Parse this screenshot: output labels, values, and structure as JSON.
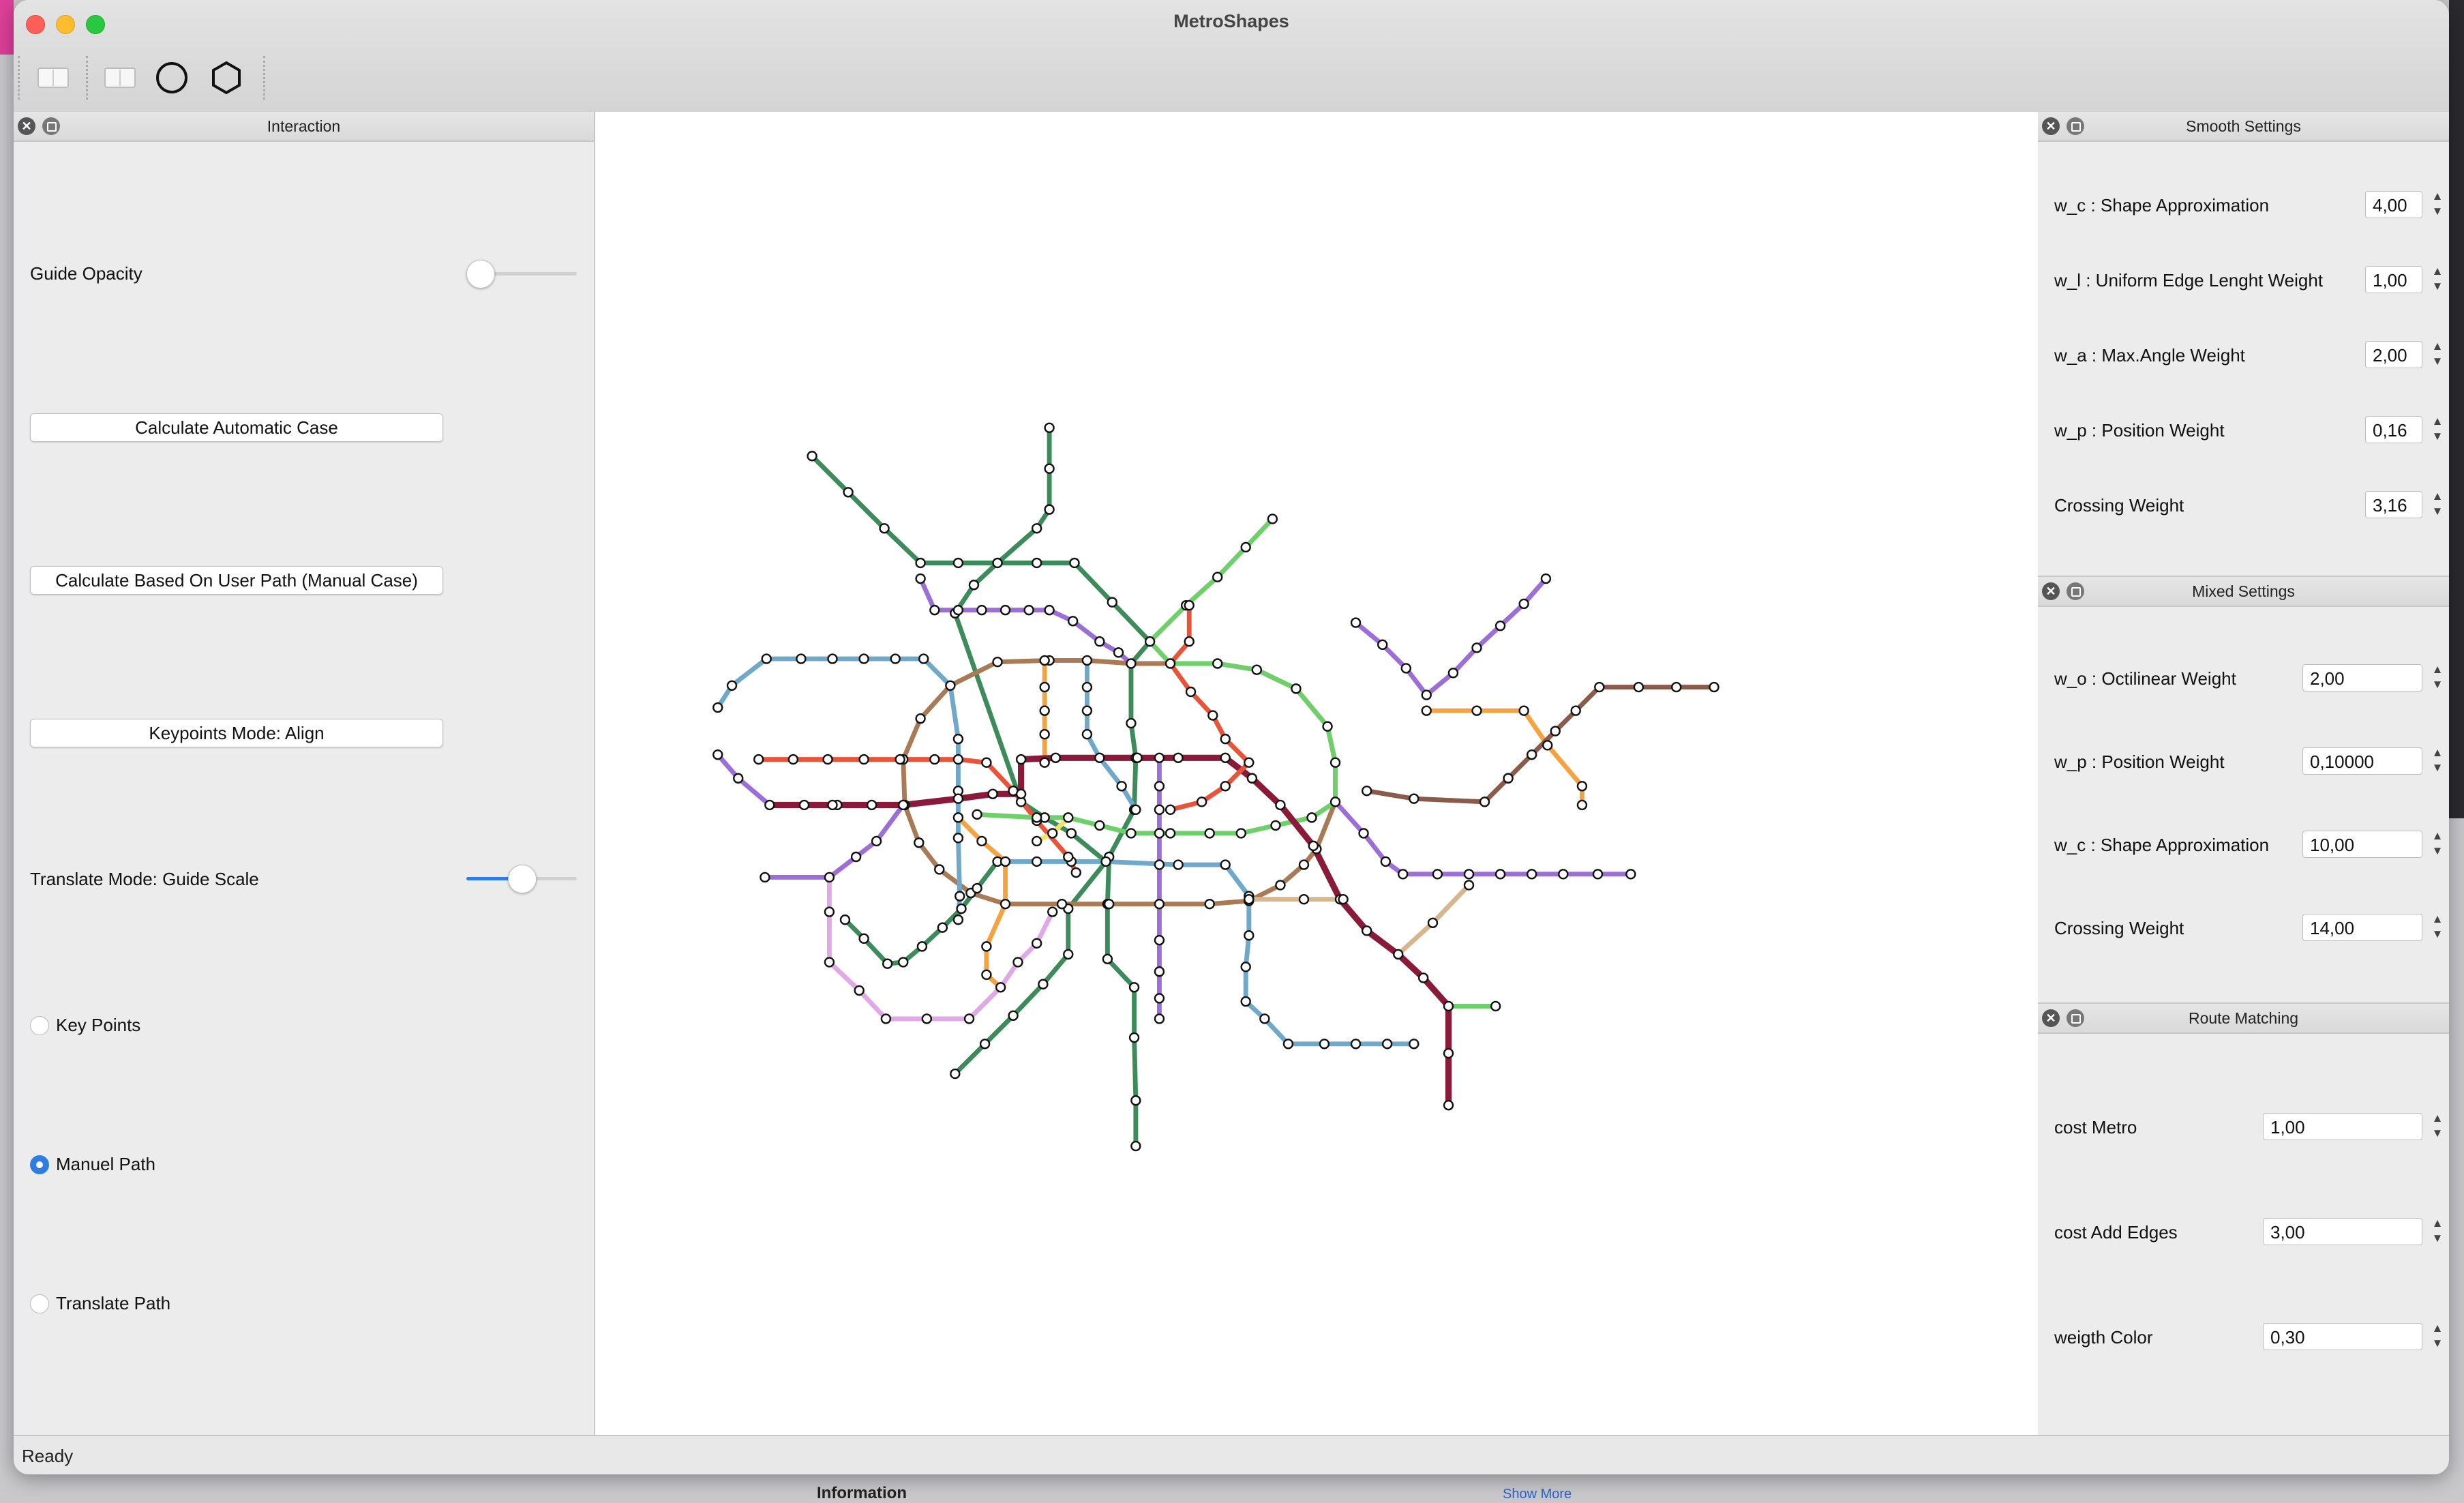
{
  "app": {
    "title": "MetroShapes"
  },
  "toolbar": {
    "icons": [
      "panel-icon",
      "panel-icon",
      "circle-icon",
      "hexagon-icon"
    ]
  },
  "interaction": {
    "title": "Interaction",
    "guide_opacity_label": "Guide Opacity",
    "guide_opacity_value": 0.0,
    "calc_auto_label": "Calculate Automatic Case",
    "calc_user_label": "Calculate Based On User Path (Manual Case)",
    "keypoints_mode_label": "Keypoints Mode: Align",
    "translate_mode_label": "Translate Mode: Guide Scale",
    "translate_scale_value": 0.5,
    "radio_key_points": "Key Points",
    "radio_manuel_path": "Manuel Path",
    "radio_translate_path": "Translate Path",
    "selected_radio": "Manuel Path"
  },
  "smooth_settings": {
    "title": "Smooth Settings",
    "rows": [
      {
        "label": "w_c : Shape Approximation",
        "value": "4,00"
      },
      {
        "label": "w_l : Uniform Edge Lenght Weight",
        "value": "1,00"
      },
      {
        "label": "w_a : Max.Angle Weight",
        "value": "2,00"
      },
      {
        "label": "w_p : Position Weight",
        "value": "0,16"
      },
      {
        "label": "Crossing Weight",
        "value": "3,16"
      }
    ]
  },
  "mixed_settings": {
    "title": "Mixed Settings",
    "rows": [
      {
        "label": "w_o : Octilinear Weight",
        "value": "2,00"
      },
      {
        "label": "w_p : Position Weight",
        "value": "0,10000"
      },
      {
        "label": "w_c : Shape Approximation",
        "value": "10,00"
      },
      {
        "label": "Crossing Weight",
        "value": "14,00"
      }
    ]
  },
  "route_matching": {
    "title": "Route Matching",
    "rows": [
      {
        "label": "cost Metro",
        "value": "1,00"
      },
      {
        "label": "cost Add Edges",
        "value": "3,00"
      },
      {
        "label": "weigth Color",
        "value": "0,30"
      }
    ]
  },
  "status": {
    "text": "Ready"
  },
  "background": {
    "info_text": "Information",
    "show_more_text": "Show More"
  },
  "colors": {
    "accent": "#2f7de1",
    "line_teal_green": "#3d8a5a",
    "line_brown": "#a87a55",
    "line_blue": "#6fa8c8",
    "line_red": "#e8543a",
    "line_purple": "#9b6fd6",
    "line_lightgreen": "#6fcf6a",
    "line_orange": "#f5a340",
    "line_darkred": "#8a1a3a",
    "line_pink": "#e2a7e6",
    "line_darkbrown": "#8a5a4a"
  }
}
